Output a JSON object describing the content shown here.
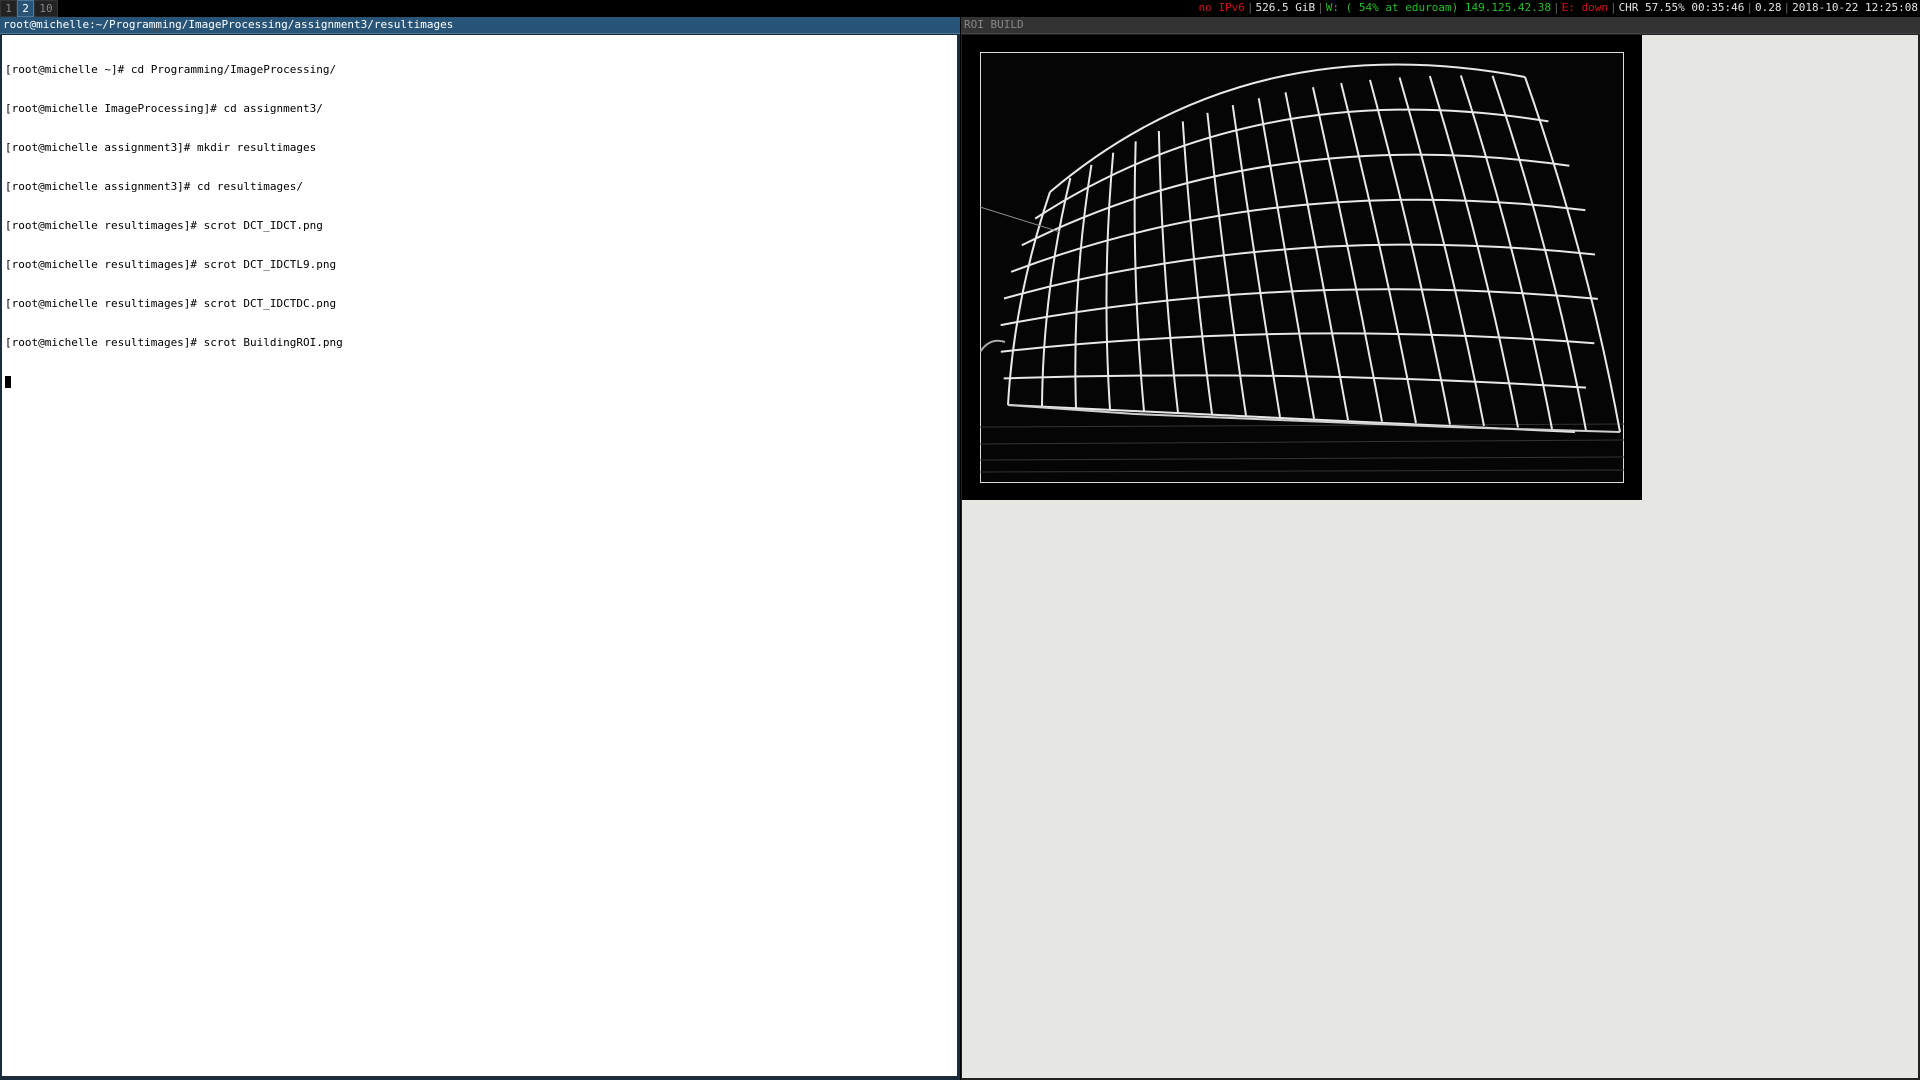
{
  "workspaces": [
    {
      "label": "1",
      "active": false
    },
    {
      "label": "2",
      "active": true
    },
    {
      "label": "10",
      "active": false
    }
  ],
  "status": {
    "ipv6": "no IPv6",
    "disk": "526.5 GiB",
    "wifi_prefix": "W:",
    "wifi_info": "( 54% at eduroam)",
    "ip": "149.125.42.38",
    "ethernet": "E: down",
    "battery": "CHR 57.55% 00:35:46",
    "load": "0.28",
    "datetime": "2018-10-22 12:25:08",
    "colors": {
      "bad": "#d01010",
      "good": "#22c022"
    }
  },
  "terminal": {
    "title": "root@michelle:~/Programming/ImageProcessing/assignment3/resultimages",
    "lines": [
      "[root@michelle ~]# cd Programming/ImageProcessing/",
      "[root@michelle ImageProcessing]# cd assignment3/",
      "[root@michelle assignment3]# mkdir resultimages",
      "[root@michelle assignment3]# cd resultimages/",
      "[root@michelle resultimages]# scrot DCT_IDCT.png",
      "[root@michelle resultimages]# scrot DCT_IDCTL9.png",
      "[root@michelle resultimages]# scrot DCT_IDCTDC.png",
      "[root@michelle resultimages]# scrot BuildingROI.png"
    ]
  },
  "image_window": {
    "title": "ROI BUILD",
    "image_icon": "edge-detected-building-image"
  },
  "colors": {
    "focused_title": "#285577",
    "unfocused_title": "#333333",
    "viewer_bg": "#e6e6e3"
  }
}
